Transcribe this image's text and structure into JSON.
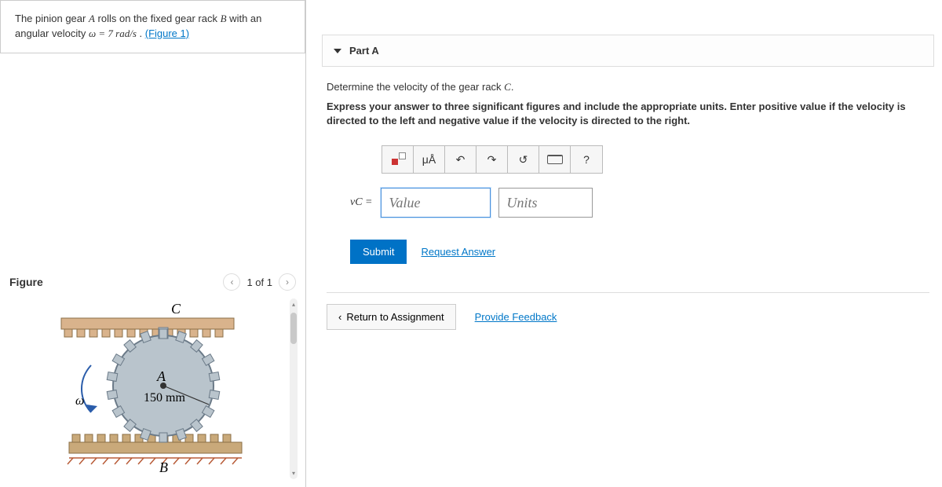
{
  "prompt": {
    "prefix": "The pinion gear ",
    "gearA": "A",
    "mid1": " rolls on the fixed gear rack ",
    "gearB": "B",
    "mid2": " with an angular velocity ",
    "omegaExpr": "ω = 7  rad/s",
    "suffix": " . ",
    "figLink": "(Figure 1)"
  },
  "figure": {
    "title": "Figure",
    "count": "1 of 1",
    "labelC": "C",
    "labelA": "A",
    "labelB": "B",
    "radius": "150 mm",
    "omegaSym": "ω"
  },
  "part": {
    "label": "Part A",
    "question_prefix": "Determine the velocity of the gear rack ",
    "question_var": "C",
    "question_suffix": ".",
    "instructions": "Express your answer to three significant figures and include the appropriate units. Enter positive value if the velocity is directed to the left and negative value if the velocity is directed to the right.",
    "toolbar": {
      "units_symbol": "μÅ",
      "undo": "↶",
      "redo": "↷",
      "reset": "↺",
      "help": "?"
    },
    "answer": {
      "label": "vC =",
      "value_ph": "Value",
      "units_ph": "Units"
    },
    "submit": "Submit",
    "request": "Request Answer"
  },
  "footer": {
    "return": "Return to Assignment",
    "feedback": "Provide Feedback"
  }
}
